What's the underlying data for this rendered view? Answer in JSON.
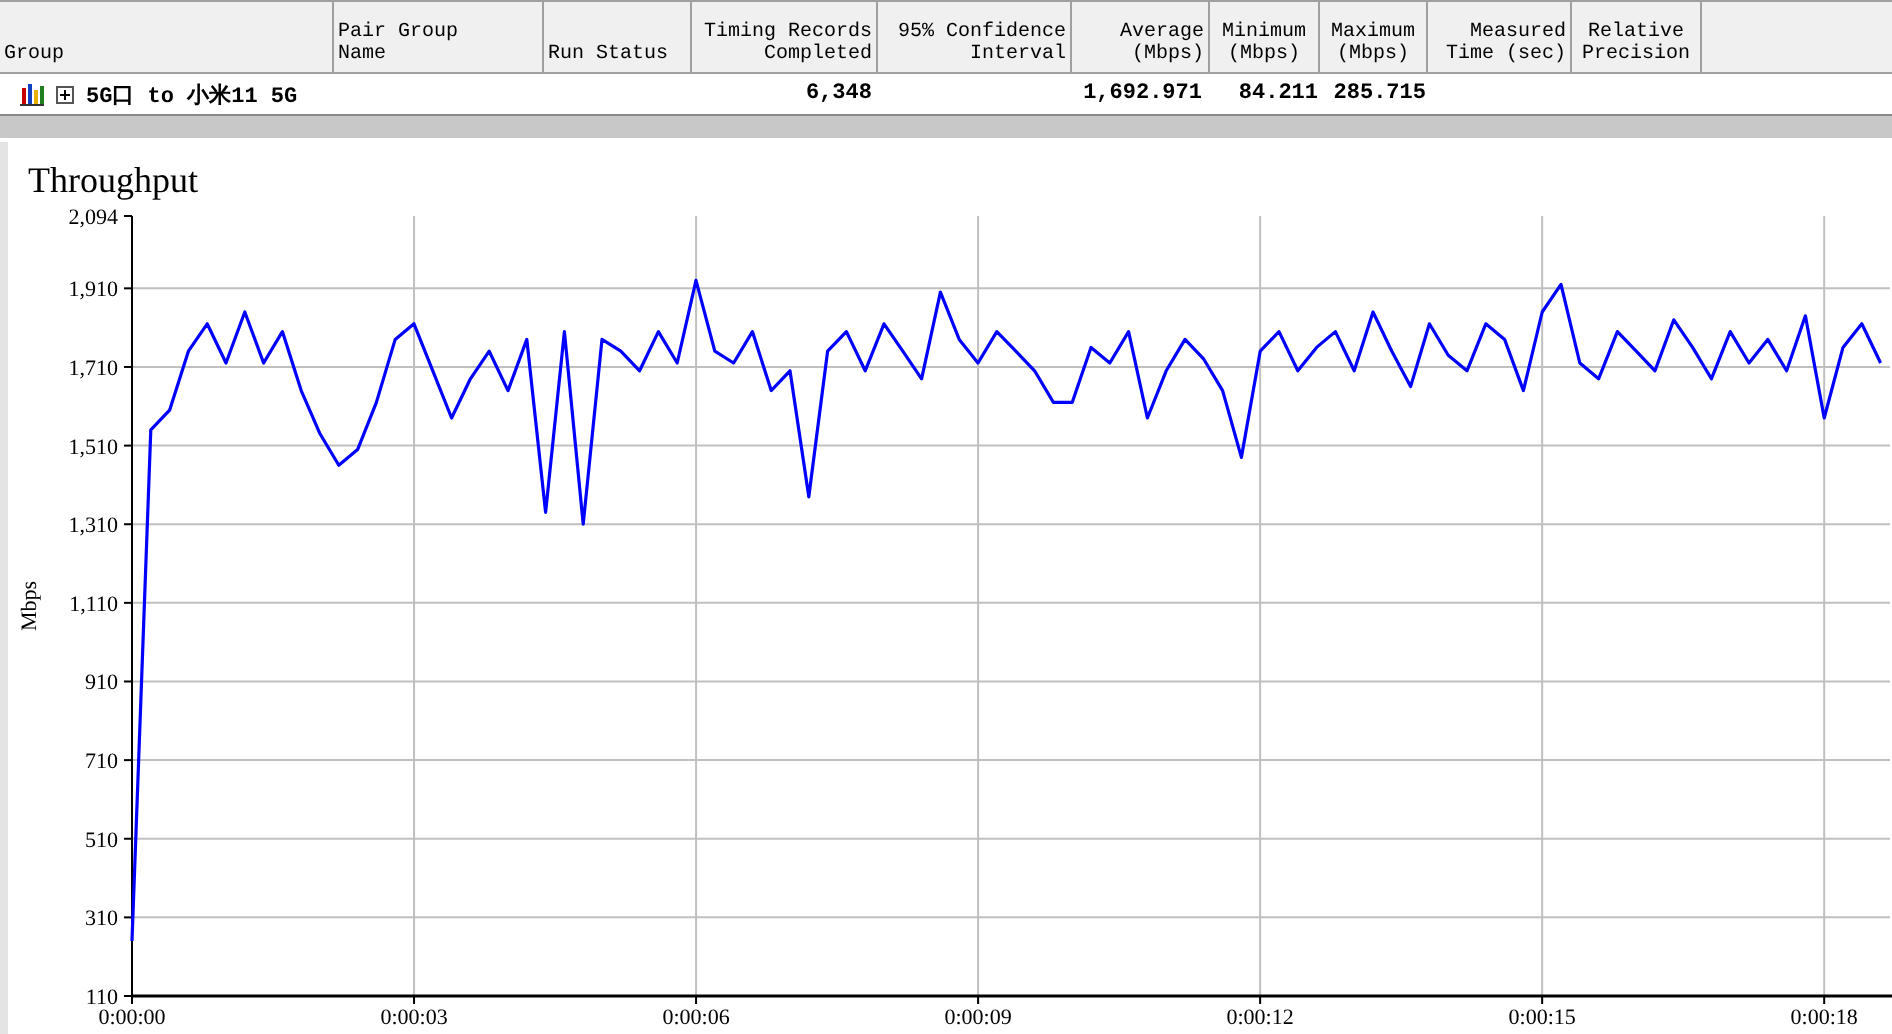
{
  "table": {
    "columns": [
      "Group",
      "Pair Group\nName",
      "Run Status",
      "Timing Records\nCompleted",
      "95% Confidence\nInterval",
      "Average\n(Mbps)",
      "Minimum\n(Mbps)",
      "Maximum\n(Mbps)",
      "Measured\nTime (sec)",
      "Relative\nPrecision"
    ],
    "rows": [
      {
        "expanded": false,
        "group": "5G口 to 小米11 5G",
        "timing_records_completed": "6,348",
        "average": "1,692.971",
        "minimum": "84.211",
        "maximum": "285.715"
      }
    ]
  },
  "chart": {
    "title": "Throughput",
    "chart_data": {
      "type": "line",
      "grid": true,
      "ylabel": "Mbps",
      "xlim": [
        0,
        18.7
      ],
      "ylim": [
        110,
        2094
      ],
      "xticks": [
        {
          "value": 0,
          "label": "0:00:00"
        },
        {
          "value": 3,
          "label": "0:00:03"
        },
        {
          "value": 6,
          "label": "0:00:06"
        },
        {
          "value": 9,
          "label": "0:00:09"
        },
        {
          "value": 12,
          "label": "0:00:12"
        },
        {
          "value": 15,
          "label": "0:00:15"
        },
        {
          "value": 18,
          "label": "0:00:18"
        }
      ],
      "yticks": [
        {
          "value": 110,
          "label": "110"
        },
        {
          "value": 310,
          "label": "310"
        },
        {
          "value": 510,
          "label": "510"
        },
        {
          "value": 710,
          "label": "710"
        },
        {
          "value": 910,
          "label": "910"
        },
        {
          "value": 1110,
          "label": "1,110"
        },
        {
          "value": 1310,
          "label": "1,310"
        },
        {
          "value": 1510,
          "label": "1,510"
        },
        {
          "value": 1710,
          "label": "1,710"
        },
        {
          "value": 1910,
          "label": "1,910"
        },
        {
          "value": 2094,
          "label": "2,094"
        }
      ],
      "x": [
        0,
        0.2,
        0.4,
        0.6,
        0.8,
        1,
        1.2,
        1.4,
        1.6,
        1.8,
        2,
        2.2,
        2.4,
        2.6,
        2.8,
        3,
        3.2,
        3.4,
        3.6,
        3.8,
        4,
        4.2,
        4.4,
        4.6,
        4.8,
        5,
        5.2,
        5.4,
        5.6,
        5.8,
        6,
        6.2,
        6.4,
        6.6,
        6.8,
        7,
        7.2,
        7.4,
        7.6,
        7.8,
        8,
        8.2,
        8.4,
        8.6,
        8.8,
        9,
        9.2,
        9.4,
        9.6,
        9.8,
        10,
        10.2,
        10.4,
        10.6,
        10.8,
        11,
        11.2,
        11.4,
        11.6,
        11.8,
        12,
        12.2,
        12.4,
        12.6,
        12.8,
        13,
        13.2,
        13.4,
        13.6,
        13.8,
        14,
        14.2,
        14.4,
        14.6,
        14.8,
        15,
        15.2,
        15.4,
        15.6,
        15.8,
        16,
        16.2,
        16.4,
        16.6,
        16.8,
        17,
        17.2,
        17.4,
        17.6,
        17.8,
        18,
        18.2,
        18.4,
        18.6
      ],
      "series": [
        {
          "color": "#0000ff",
          "values": [
            250,
            1550,
            1600,
            1750,
            1820,
            1720,
            1850,
            1720,
            1800,
            1650,
            1540,
            1460,
            1500,
            1620,
            1780,
            1820,
            1700,
            1580,
            1680,
            1750,
            1650,
            1780,
            1340,
            1800,
            1310,
            1780,
            1750,
            1700,
            1800,
            1720,
            1930,
            1750,
            1720,
            1800,
            1650,
            1700,
            1380,
            1750,
            1800,
            1700,
            1820,
            1750,
            1680,
            1900,
            1780,
            1720,
            1800,
            1750,
            1700,
            1620,
            1620,
            1760,
            1720,
            1800,
            1580,
            1700,
            1780,
            1730,
            1650,
            1480,
            1750,
            1800,
            1700,
            1760,
            1800,
            1700,
            1850,
            1750,
            1660,
            1820,
            1740,
            1700,
            1820,
            1780,
            1650,
            1850,
            1920,
            1720,
            1680,
            1800,
            1750,
            1700,
            1830,
            1760,
            1680,
            1800,
            1720,
            1780,
            1700,
            1840,
            1580,
            1760,
            1820,
            1720
          ]
        }
      ]
    }
  }
}
